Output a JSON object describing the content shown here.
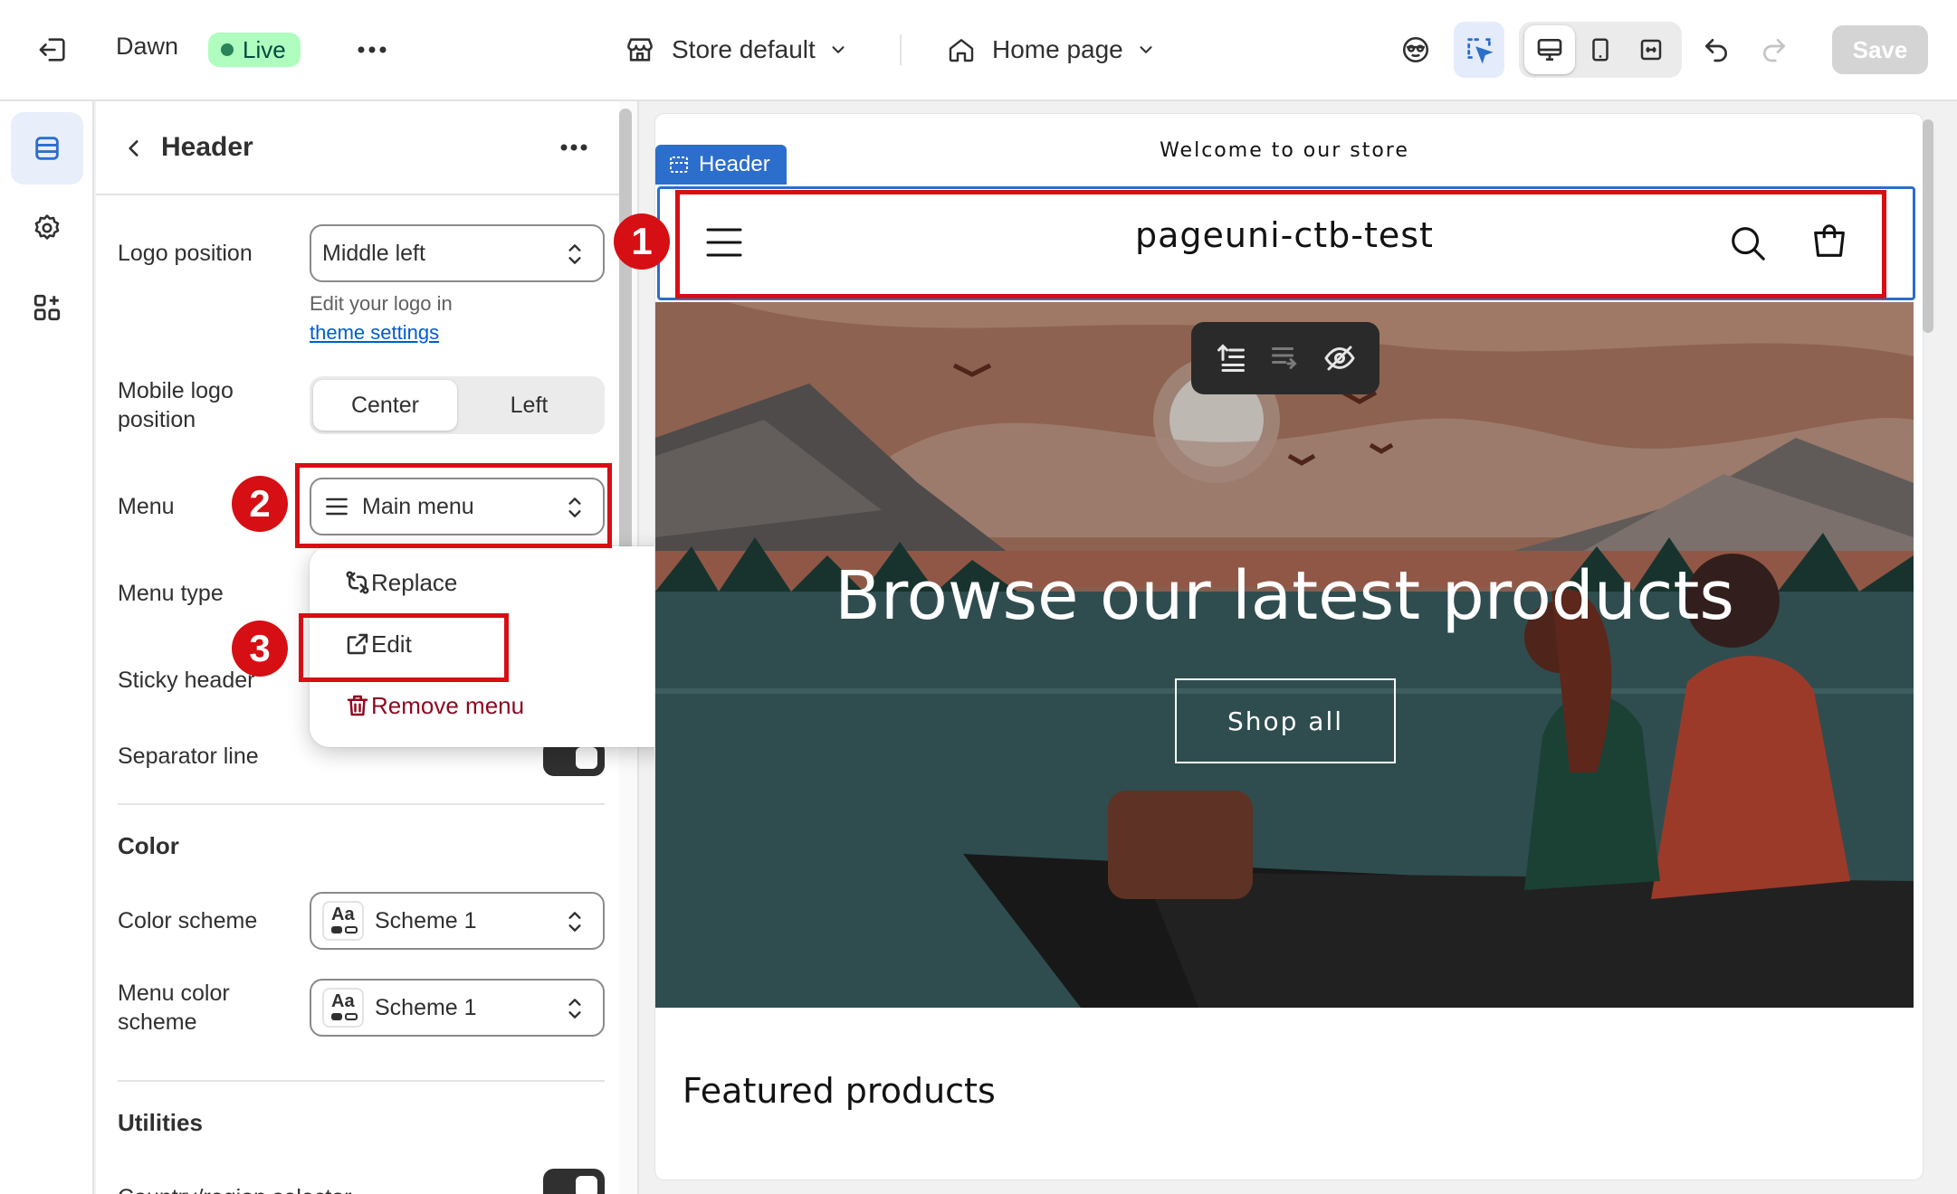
{
  "topbar": {
    "theme_name": "Dawn",
    "live_badge": "Live",
    "store_selector": "Store default",
    "page_selector": "Home page",
    "save_label": "Save"
  },
  "panel": {
    "title": "Header",
    "logo_position_label": "Logo position",
    "logo_position_value": "Middle left",
    "logo_helper_text": "Edit your logo in",
    "logo_helper_link": "theme settings",
    "mobile_logo_label": "Mobile logo position",
    "mobile_logo_options": [
      "Center",
      "Left"
    ],
    "mobile_logo_selected": "Center",
    "menu_label": "Menu",
    "menu_value": "Main menu",
    "menu_type_label": "Menu type",
    "sticky_header_label": "Sticky header",
    "separator_line_label": "Separator line",
    "color_section": "Color",
    "color_scheme_label": "Color scheme",
    "color_scheme_value": "Scheme 1",
    "menu_color_scheme_label": "Menu color scheme",
    "menu_color_scheme_value": "Scheme 1",
    "utilities_section": "Utilities",
    "country_selector_label": "Country/region selector",
    "aa_glyph": "Aa"
  },
  "popover": {
    "items": [
      {
        "label": "Replace",
        "icon": "replace-icon"
      },
      {
        "label": "Edit",
        "icon": "external-edit-icon"
      },
      {
        "label": "Remove menu",
        "icon": "trash-icon"
      }
    ]
  },
  "annotations": {
    "step1": "1",
    "step2": "2",
    "step3": "3",
    "color": "#d60f14"
  },
  "preview": {
    "announcement": "Welcome to our store",
    "header_tag": "Header",
    "store_name": "pageuni-ctb-test",
    "hero_title": "Browse our latest products",
    "hero_button": "Shop all",
    "featured_title": "Featured products"
  },
  "colors": {
    "accent_blue": "#2c6ecb",
    "live_green": "#affebf",
    "save_disabled": "#d4d4d4"
  }
}
